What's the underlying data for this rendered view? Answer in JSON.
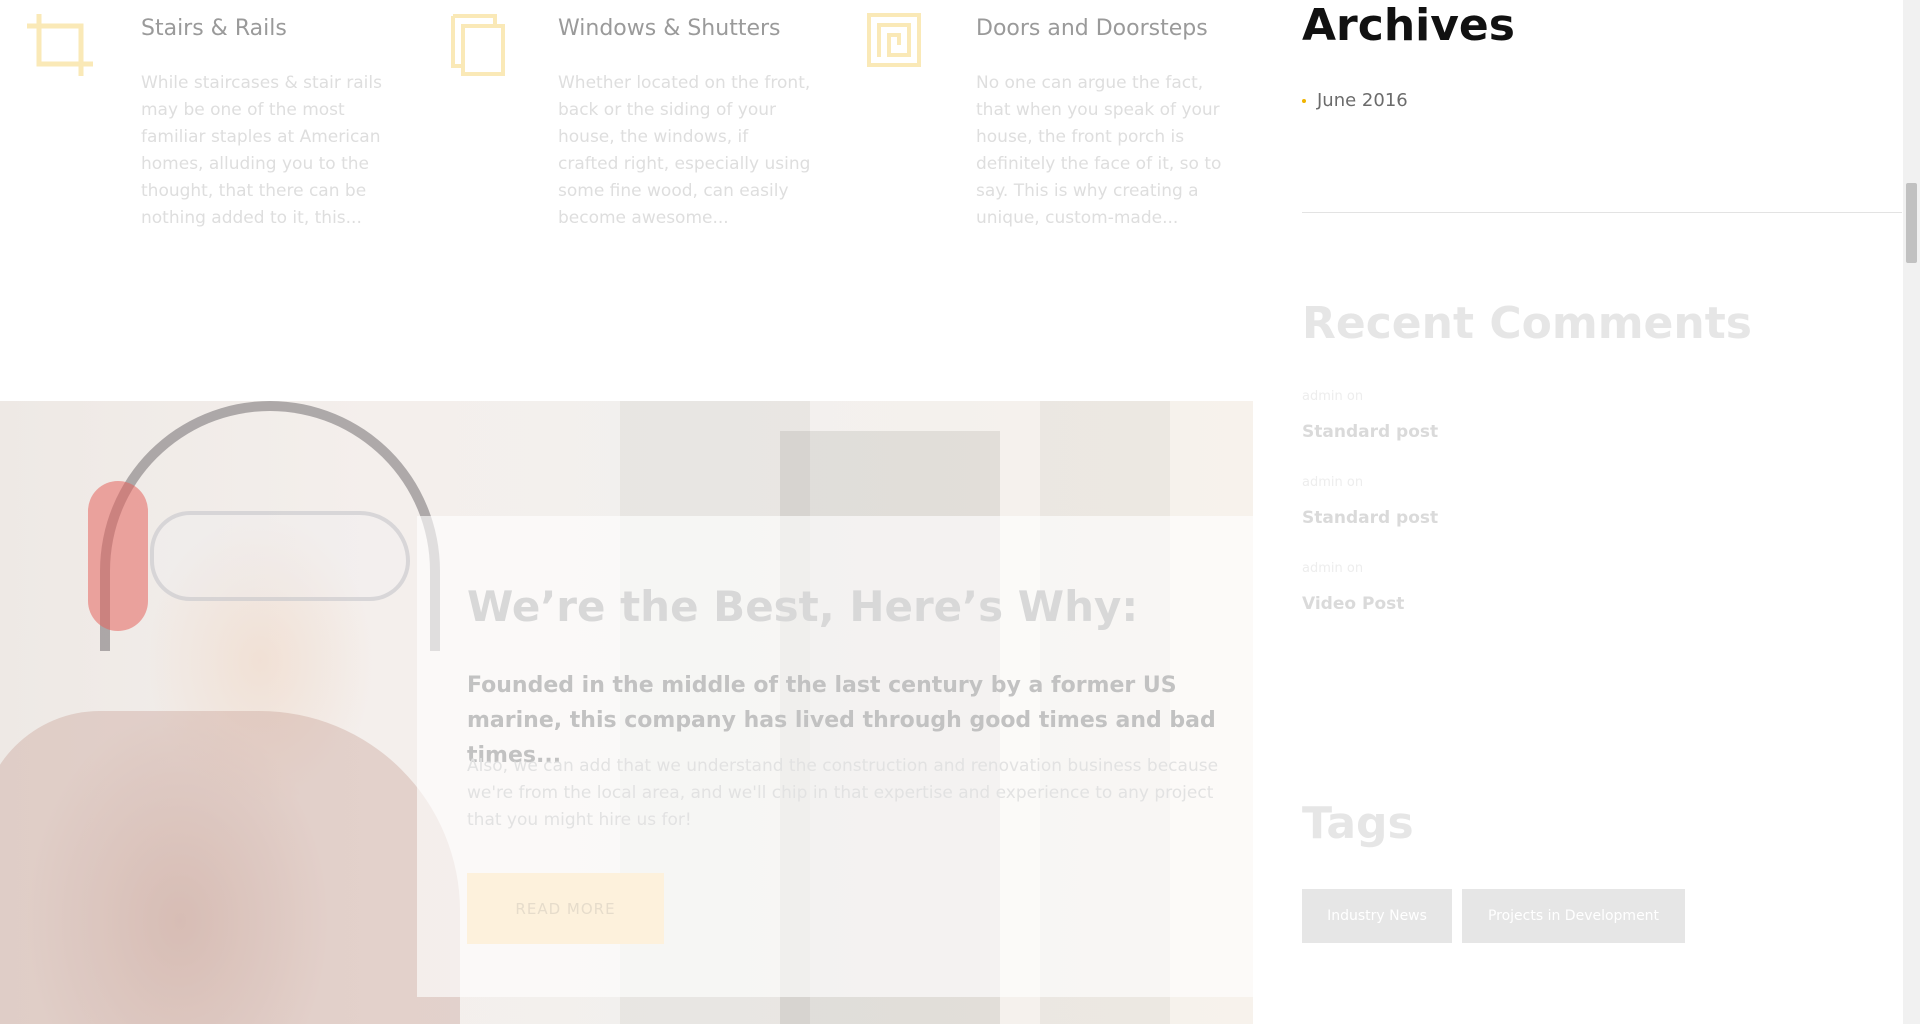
{
  "services": [
    {
      "icon": "crop-icon",
      "title": "Stairs & Rails",
      "excerpt": "While staircases & stair rails may be one of the most familiar staples at American homes, alluding you to the thought, that there can be nothing added to it, this..."
    },
    {
      "icon": "copy-icon",
      "title": "Windows & Shutters",
      "excerpt": "Whether located on the front, back or the siding of your house, the windows, if crafted right, especially using some fine wood, can easily become awesome..."
    },
    {
      "icon": "spiral-square-icon",
      "title": "Doors and Doorsteps",
      "excerpt": "No one can argue the fact, that when you speak of your house, the front porch is definitely the face of it, so to say. This is why creating a unique, custom-made..."
    }
  ],
  "hero": {
    "title": "We’re the Best, Here’s Why:",
    "lead": "Founded in the middle of the last century by a former US marine, this company has lived through good times and bad times...",
    "body": "Also, we can add that we understand the construction and renovation business because we're from the local area, and we'll chip in that expertise and experience to any project that you might hire us for!",
    "button_label": "READ MORE"
  },
  "sidebar": {
    "archives": {
      "title": "Archives",
      "items": [
        "June 2016"
      ]
    },
    "recent_comments": {
      "title": "Recent Comments",
      "items": [
        {
          "author": "admin",
          "on": "on",
          "post": "Standard post"
        },
        {
          "author": "admin",
          "on": "on",
          "post": "Standard post"
        },
        {
          "author": "admin",
          "on": "on",
          "post": "Video Post"
        }
      ]
    },
    "tags": {
      "title": "Tags",
      "items": [
        "Industry News",
        "Projects in Development"
      ]
    }
  },
  "colors": {
    "accent": "#f0b400",
    "heading_dark": "#111111",
    "tag_bg": "#e6e6e6"
  }
}
